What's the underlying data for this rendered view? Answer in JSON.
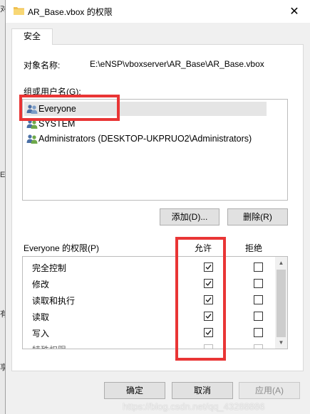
{
  "window": {
    "title": "AR_Base.vbox 的权限",
    "close_glyph": "✕"
  },
  "background_fragments": [
    "对",
    "Eve",
    "有",
    "享"
  ],
  "tab": {
    "label": "安全"
  },
  "object": {
    "label": "对象名称:",
    "value": "E:\\eNSP\\vboxserver\\AR_Base\\AR_Base.vbox"
  },
  "groups": {
    "label": "组或用户名(G):",
    "items": [
      {
        "name": "Everyone",
        "selected": true
      },
      {
        "name": "SYSTEM",
        "selected": false
      },
      {
        "name": "Administrators (DESKTOP-UKPRUO2\\Administrators)",
        "selected": false
      }
    ]
  },
  "buttons": {
    "add": "添加(D)...",
    "remove": "删除(R)",
    "ok": "确定",
    "cancel": "取消",
    "apply": "应用(A)"
  },
  "permissions": {
    "label": "Everyone 的权限(P)",
    "allow_header": "允许",
    "deny_header": "拒绝",
    "rows": [
      {
        "name": "完全控制",
        "allow": true,
        "deny": false
      },
      {
        "name": "修改",
        "allow": true,
        "deny": false
      },
      {
        "name": "读取和执行",
        "allow": true,
        "deny": false
      },
      {
        "name": "读取",
        "allow": true,
        "deny": false
      },
      {
        "name": "写入",
        "allow": true,
        "deny": false
      },
      {
        "name": "特殊权限",
        "allow": false,
        "deny": false
      }
    ]
  },
  "watermark": "https://blog.csdn.net/qq_43288886",
  "colors": {
    "highlight_box": "#e93535",
    "selection": "#e5e5e5"
  },
  "icons": {
    "title": "folder-icon",
    "user": "user-group-icon",
    "close": "close-icon"
  }
}
